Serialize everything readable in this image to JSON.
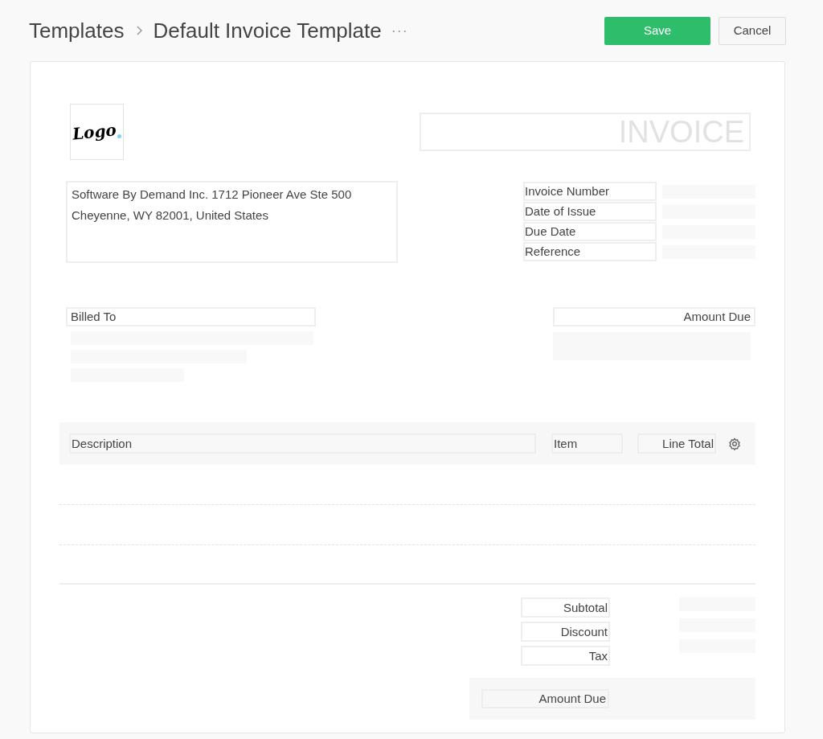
{
  "breadcrumb": [
    {
      "label": "Templates"
    },
    {
      "label": "Default Invoice Template"
    }
  ],
  "more": "···",
  "buttons": [
    {
      "label": "Save",
      "kind": "primary"
    },
    {
      "label": "Cancel",
      "kind": "secondary"
    }
  ],
  "logo": "Logo",
  "invoice_title": "INVOICE",
  "address_lines": [
    "Software By Demand Inc. 1712 Pioneer Ave Ste 500",
    "Cheyenne, WY 82001, United States"
  ],
  "meta_fields": [
    "Invoice Number",
    "Date of Issue",
    "Due Date",
    "Reference"
  ],
  "billed_to": "Billed To",
  "amount_due": "Amount Due",
  "table": {
    "columns": [
      {
        "label": "Description"
      },
      {
        "label": "Item"
      },
      {
        "label": "Line Total"
      }
    ]
  },
  "summary": [
    "Subtotal",
    "Discount",
    "Tax"
  ],
  "total": "Amount Due"
}
